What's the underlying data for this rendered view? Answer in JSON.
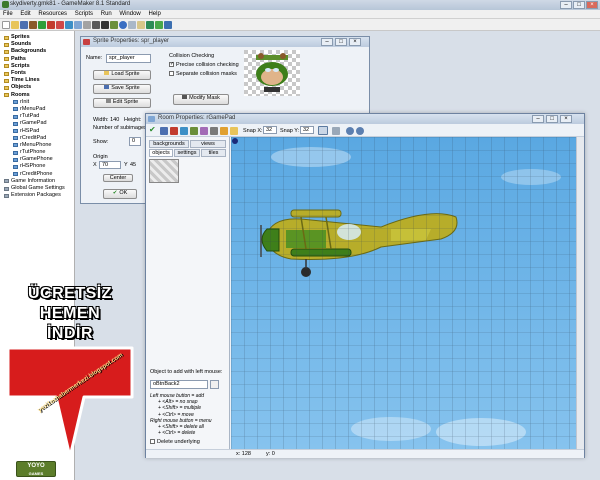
{
  "window": {
    "title": "skydiverty.gmk81 - GameMaker 8.1 Standard",
    "controls": [
      "–",
      "□",
      "×"
    ]
  },
  "menu": [
    "File",
    "Edit",
    "Resources",
    "Scripts",
    "Run",
    "Window",
    "Help"
  ],
  "tree": [
    {
      "label": "Sprites",
      "kind": "folder",
      "bold": true,
      "indent": 0
    },
    {
      "label": "Sounds",
      "kind": "folder",
      "bold": true,
      "indent": 0
    },
    {
      "label": "Backgrounds",
      "kind": "folder",
      "bold": true,
      "indent": 0
    },
    {
      "label": "Paths",
      "kind": "folder",
      "bold": true,
      "indent": 0
    },
    {
      "label": "Scripts",
      "kind": "folder",
      "bold": true,
      "indent": 0
    },
    {
      "label": "Fonts",
      "kind": "folder",
      "bold": true,
      "indent": 0
    },
    {
      "label": "Time Lines",
      "kind": "folder",
      "bold": true,
      "indent": 0
    },
    {
      "label": "Objects",
      "kind": "folder",
      "bold": true,
      "indent": 0
    },
    {
      "label": "Rooms",
      "kind": "folder",
      "bold": true,
      "indent": 0
    },
    {
      "label": "rInit",
      "kind": "room",
      "bold": false,
      "indent": 1
    },
    {
      "label": "rMenuPad",
      "kind": "room",
      "bold": false,
      "indent": 1
    },
    {
      "label": "rTutPad",
      "kind": "room",
      "bold": false,
      "indent": 1
    },
    {
      "label": "rGamePad",
      "kind": "room",
      "bold": false,
      "indent": 1
    },
    {
      "label": "rHSPad",
      "kind": "room",
      "bold": false,
      "indent": 1
    },
    {
      "label": "rCreditPad",
      "kind": "room",
      "bold": false,
      "indent": 1
    },
    {
      "label": "rMenuPhone",
      "kind": "room",
      "bold": false,
      "indent": 1
    },
    {
      "label": "rTutPhone",
      "kind": "room",
      "bold": false,
      "indent": 1
    },
    {
      "label": "rGamePhone",
      "kind": "room",
      "bold": false,
      "indent": 1
    },
    {
      "label": "rHSPhone",
      "kind": "room",
      "bold": false,
      "indent": 1
    },
    {
      "label": "rCreditPhone",
      "kind": "room",
      "bold": false,
      "indent": 1
    },
    {
      "label": "Game Information",
      "kind": "misc",
      "bold": false,
      "indent": 0
    },
    {
      "label": "Global Game Settings",
      "kind": "misc",
      "bold": false,
      "indent": 0
    },
    {
      "label": "Extension Packages",
      "kind": "misc",
      "bold": false,
      "indent": 0
    }
  ],
  "promo": {
    "line1": "ÜCRETSİZ",
    "line2": "HEMEN",
    "line3": "İNDİR",
    "url": "yezi1ozhabermerkezi.blogspot.com",
    "logo_line1": "YOYO",
    "logo_line2": "GAMES",
    "arrow_color": "#d71c1c"
  },
  "sprite_window": {
    "title": "Sprite Properties: spr_player",
    "name_label": "Name:",
    "name_value": "spr_player",
    "load_button": "Load Sprite",
    "save_button": "Save Sprite",
    "edit_button": "Edit Sprite",
    "width_text": "Width: 140",
    "height_text": "Height:",
    "subimages_text": "Number of subimages",
    "show_label": "Show:",
    "show_value": "0",
    "origin_label": "Origin",
    "x_label": "X",
    "x_value": "70",
    "y_label": "Y",
    "y_value": "45",
    "center_button": "Center",
    "ok_button": "OK",
    "collision_title": "Collision Checking",
    "precise_label": "Precise collision checking",
    "precise_checked": true,
    "separate_label": "Separate collision masks",
    "separate_checked": false,
    "modify_mask_button": "Modify Mask"
  },
  "room_window": {
    "title": "Room Properties: rGamePad",
    "snap_x_label": "Snap X:",
    "snap_x": "32",
    "snap_y_label": "Snap Y:",
    "snap_y": "32",
    "tabs_top": [
      "backgrounds",
      "views"
    ],
    "tabs_bottom": [
      "objects",
      "settings",
      "tiles"
    ],
    "add_label": "Object to add with left mouse:",
    "object_value": "oBtnBack2",
    "instructions": [
      "Left mouse button = add",
      "+ <Alt> = no snap",
      "+ <Shift> = multiple",
      "+ <Ctrl> = move",
      "Right mouse button = menu",
      "+ <Shift> = delete all",
      "+ <Ctrl> = delete"
    ],
    "delete_underlying": "Delete underlying",
    "status_x": "x: 128",
    "status_y": "y: 0"
  },
  "colors": {
    "sky": "#6fb6e8",
    "grid": "#2b3f52",
    "plane_body": "#b7ad2a",
    "plane_dark": "#3e7f1a"
  }
}
